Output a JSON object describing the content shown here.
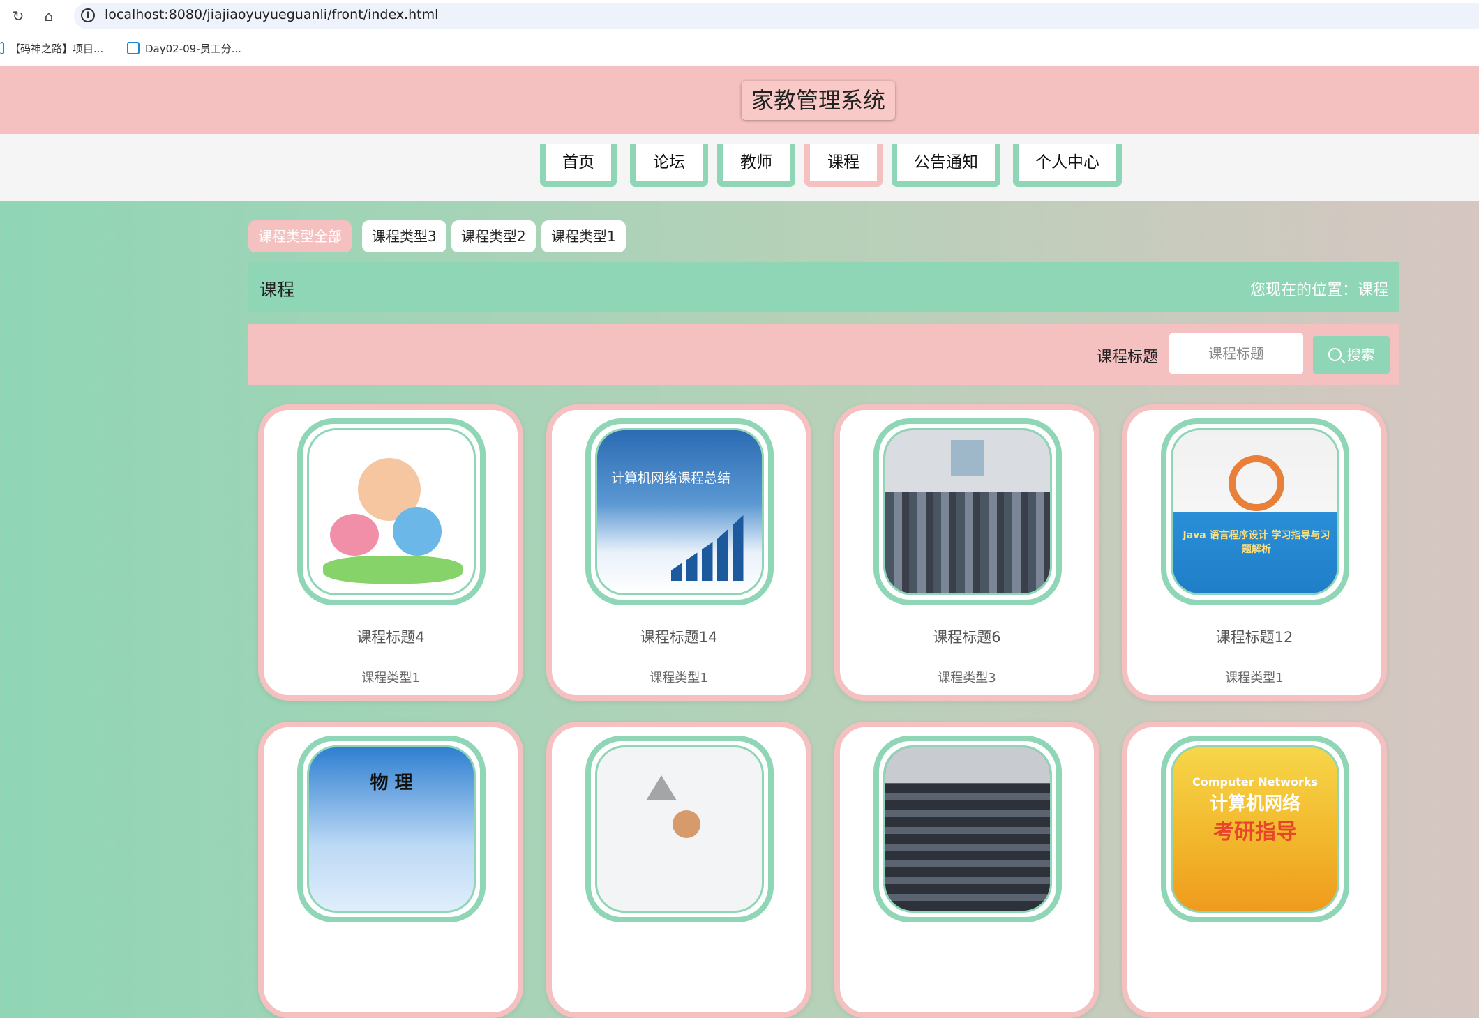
{
  "browser": {
    "url": "localhost:8080/jiajiaoyuyueguanli/front/index.html",
    "bookmarks": [
      "【码神之路】项目...",
      "Day02-09-员工分..."
    ]
  },
  "site": {
    "title": "家教管理系统",
    "nav": [
      "首页",
      "论坛",
      "教师",
      "课程",
      "公告通知",
      "个人中心"
    ],
    "active_nav": "课程"
  },
  "filters": {
    "types": [
      "课程类型全部",
      "课程类型3",
      "课程类型2",
      "课程类型1"
    ],
    "active": "课程类型全部"
  },
  "breadcrumb": {
    "title": "课程",
    "location": "您现在的位置：课程"
  },
  "search": {
    "label": "课程标题",
    "placeholder": "课程标题",
    "button": "搜索"
  },
  "images": {
    "net_caption": "计算机网络课程总结",
    "java_caption": "Java 语言程序设计 学习指导与习题解析",
    "phys_caption": "物 理",
    "cn_caption_top": "Computer Networks",
    "cn_caption_mid": "计算机网络",
    "cn_caption_bot": "考研指导"
  },
  "courses": [
    {
      "title": "课程标题4",
      "type": "课程类型1"
    },
    {
      "title": "课程标题14",
      "type": "课程类型1"
    },
    {
      "title": "课程标题6",
      "type": "课程类型3"
    },
    {
      "title": "课程标题12",
      "type": "课程类型1"
    },
    {
      "title": "",
      "type": ""
    },
    {
      "title": "",
      "type": ""
    },
    {
      "title": "",
      "type": ""
    },
    {
      "title": "",
      "type": ""
    }
  ],
  "colors": {
    "pink": "#f5c0c0",
    "mint": "#8fd6b6"
  }
}
